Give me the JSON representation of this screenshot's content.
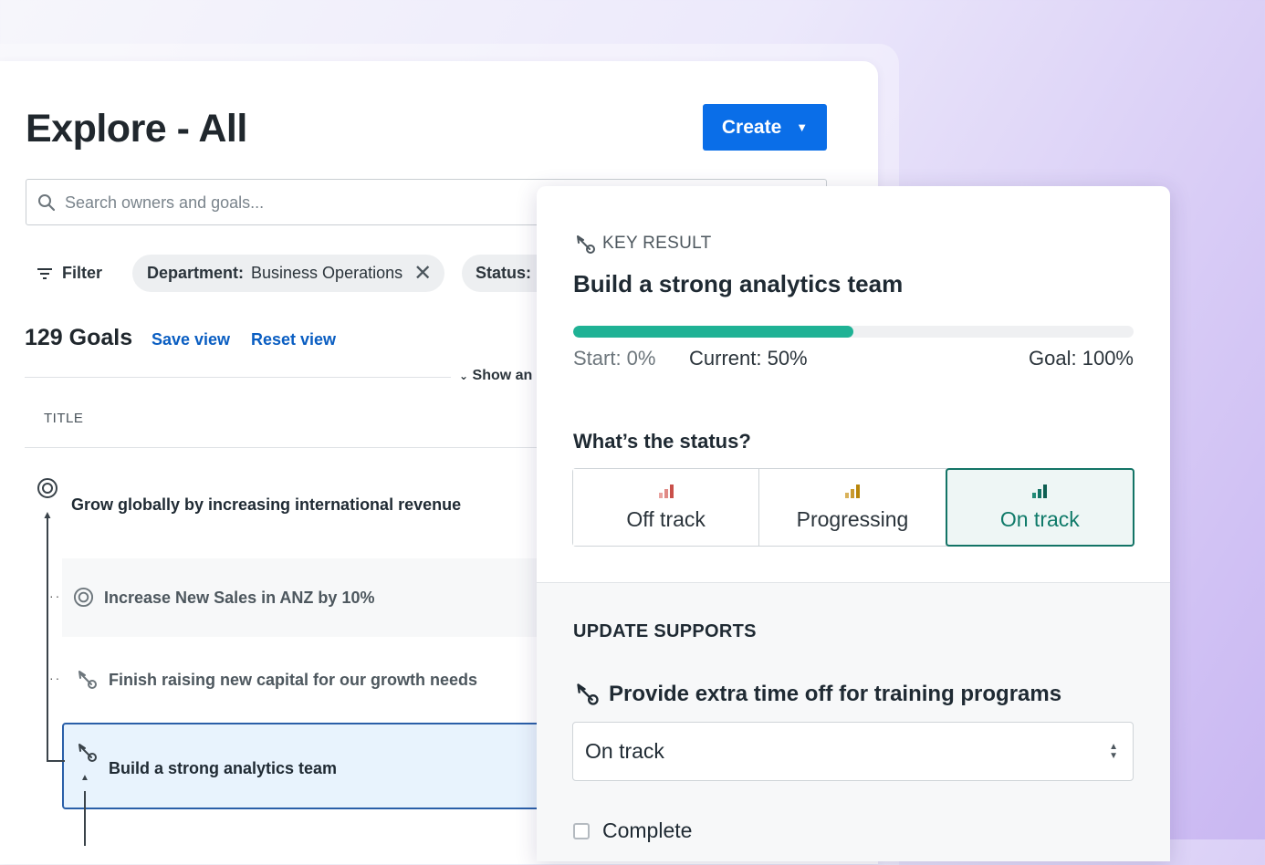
{
  "explore": {
    "title": "Explore - All",
    "create_label": "Create",
    "search_placeholder": "Search owners and goals...",
    "filter_label": "Filter",
    "chips": [
      {
        "key": "Department:",
        "value": "Business Operations"
      },
      {
        "key": "Status:",
        "value": ""
      }
    ],
    "goals_count": "129 Goals",
    "save_view": "Save view",
    "reset_view": "Reset view",
    "show_toggle": "Show an",
    "column_title": "TITLE",
    "rows": [
      {
        "title": "Grow globally by increasing international revenue",
        "icon": "goal-target-icon"
      },
      {
        "title": "Increase New Sales in ANZ by 10%",
        "icon": "goal-target-icon"
      },
      {
        "title": "Finish raising new capital for our growth needs",
        "icon": "key-result-icon"
      },
      {
        "title": "Build a strong analytics team",
        "icon": "key-result-icon"
      }
    ]
  },
  "key_result": {
    "label": "KEY RESULT",
    "title": "Build a strong analytics team",
    "progress": 0.5,
    "start": "Start: 0%",
    "current": "Current: 50%",
    "goal": "Goal: 100%",
    "status_question": "What’s the status?",
    "status_options": [
      {
        "label": "Off track",
        "colors": [
          "#e9a3a0",
          "#e08a86",
          "#c9504a"
        ]
      },
      {
        "label": "Progressing",
        "colors": [
          "#d9b25a",
          "#c99a30",
          "#b8860b"
        ]
      },
      {
        "label": "On track",
        "colors": [
          "#1f8a76",
          "#137466",
          "#0e5f52"
        ]
      }
    ],
    "selected_status": "On track",
    "update_heading": "UPDATE SUPPORTS",
    "support_item": "Provide extra time off for training programs",
    "support_status": "On track",
    "complete_label": "Complete"
  },
  "colors": {
    "accent": "#0a6ee8",
    "progress": "#1fb295",
    "on_track": "#137466"
  }
}
